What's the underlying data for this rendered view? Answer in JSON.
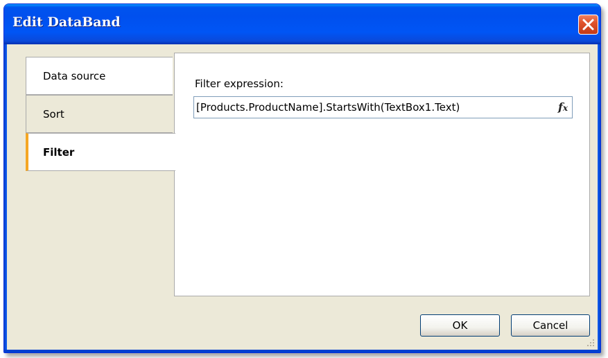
{
  "window": {
    "title": "Edit DataBand",
    "close_icon": "close-icon"
  },
  "tabs": [
    {
      "label": "Data source",
      "active": false
    },
    {
      "label": "Sort",
      "active": false
    },
    {
      "label": "Filter",
      "active": true
    }
  ],
  "filter": {
    "label": "Filter expression:",
    "value": "[Products.ProductName].StartsWith(TextBox1.Text)",
    "function_icon": "fx-icon"
  },
  "buttons": {
    "ok_label": "OK",
    "cancel_label": "Cancel"
  },
  "colors": {
    "titlebar": "#0055ea",
    "dialog_bg": "#ece9d8",
    "active_tab_marker": "#f5a623",
    "close_button": "#e0532c"
  }
}
